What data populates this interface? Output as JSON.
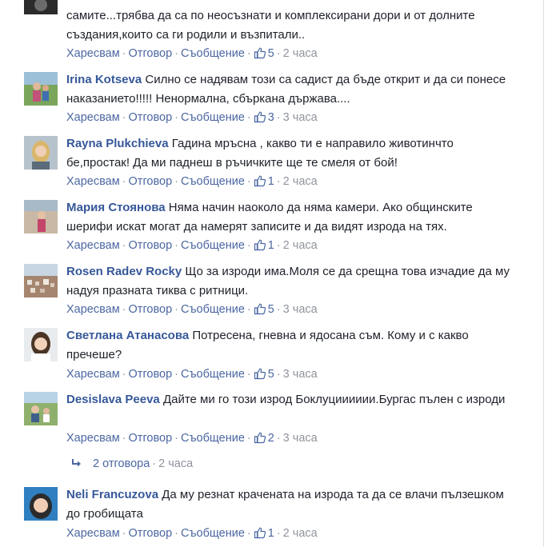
{
  "comments": [
    {
      "author": "",
      "text": "самите...трябва да са по неосъзнати и комплексирани дори и от долните създания,които са ги родили и възпитали..",
      "like_label": "Харесвам",
      "reply_label": "Отговор",
      "message_label": "Съобщение",
      "likes": "5",
      "time": "2 часа"
    },
    {
      "author": "Irina Kotseva",
      "text": "Силно се надявам този са садист да бъде открит и да си понесе наказанието!!!!! Ненормална, сбъркана държава....",
      "like_label": "Харесвам",
      "reply_label": "Отговор",
      "message_label": "Съобщение",
      "likes": "3",
      "time": "3 часа"
    },
    {
      "author": "Rayna Plukchieva",
      "text": "Гадина мръсна , какво ти е направило животинчто бе,простак! Да ми паднеш в ръчичките ще те смеля от бой!",
      "like_label": "Харесвам",
      "reply_label": "Отговор",
      "message_label": "Съобщение",
      "likes": "1",
      "time": "2 часа"
    },
    {
      "author": "Мария Стоянова",
      "text": "Няма начин наоколо да няма камери. Ако общинските шерифи искат могат да намерят записите и да видят изрода на тях.",
      "like_label": "Харесвам",
      "reply_label": "Отговор",
      "message_label": "Съобщение",
      "likes": "1",
      "time": "2 часа"
    },
    {
      "author": "Rosen Radev Rocky",
      "text": "Що за изроди има.Моля се да срещна това изчадие да му надуя празната тиква с ритници.",
      "like_label": "Харесвам",
      "reply_label": "Отговор",
      "message_label": "Съобщение",
      "likes": "5",
      "time": "3 часа"
    },
    {
      "author": "Светлана Атанасова",
      "text": "Потресена, гневна и ядосана съм. Кому и с какво пречеше?",
      "like_label": "Харесвам",
      "reply_label": "Отговор",
      "message_label": "Съобщение",
      "likes": "5",
      "time": "3 часа"
    },
    {
      "author": "Desislava Peeva",
      "text": "Дайте ми го този изрод Боклуцииииии.Бургас пълен с изроди",
      "like_label": "Харесвам",
      "reply_label": "Отговор",
      "message_label": "Съобщение",
      "likes": "2",
      "time": "3 часа"
    },
    {
      "author": "Neli Francuzova",
      "text": "Да му резнат крачената на изрода та да се влачи пълзешком до гробищата",
      "like_label": "Харесвам",
      "reply_label": "Отговор",
      "message_label": "Съобщение",
      "likes": "1",
      "time": "2 часа"
    }
  ],
  "replies_row": {
    "label": "2 отговора",
    "time": "2 часа"
  },
  "colors": {
    "link": "#365899",
    "meta": "#90949c",
    "text": "#1d2129"
  }
}
